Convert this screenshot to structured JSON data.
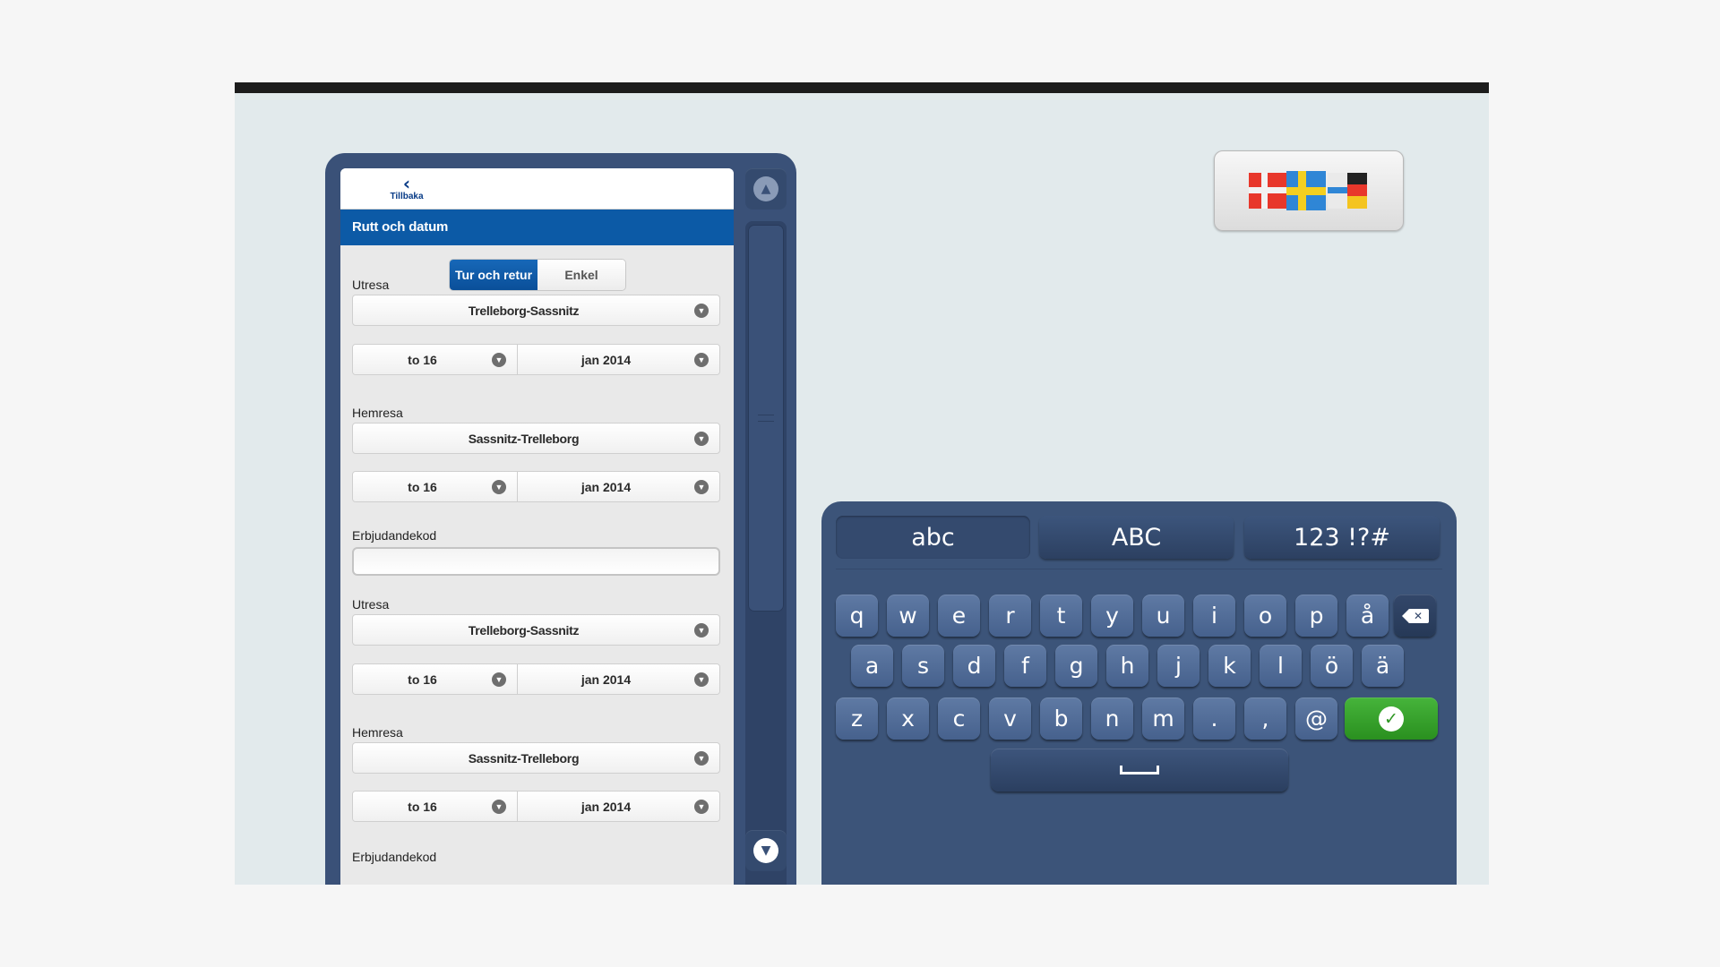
{
  "nav": {
    "back_label": "Tillbaka",
    "back_icon": "chevron-left-icon"
  },
  "section": {
    "title": "Rutt och datum"
  },
  "trip_type": {
    "options": [
      "Tur och retur",
      "Enkel"
    ],
    "selected": "Tur och retur"
  },
  "form": {
    "outbound_1": {
      "label": "Utresa",
      "route": "Trelleborg-Sassnitz",
      "day": "to 16",
      "month": "jan 2014"
    },
    "return_1": {
      "label": "Hemresa",
      "route": "Sassnitz-Trelleborg",
      "day": "to 16",
      "month": "jan 2014"
    },
    "promo_1": {
      "label": "Erbjudandekod",
      "value": ""
    },
    "outbound_2": {
      "label": "Utresa",
      "route": "Trelleborg-Sassnitz",
      "day": "to 16",
      "month": "jan 2014"
    },
    "return_2": {
      "label": "Hemresa",
      "route": "Sassnitz-Trelleborg",
      "day": "to 16",
      "month": "jan 2014"
    },
    "promo_2": {
      "label": "Erbjudandekod"
    }
  },
  "scroll": {
    "up_icon": "chevron-up-icon",
    "down_icon": "chevron-down-icon",
    "position": 0
  },
  "language": {
    "icon": "flags-icon",
    "flags": [
      "Denmark",
      "Sweden",
      "Germany"
    ]
  },
  "keyboard": {
    "modes": [
      "abc",
      "ABC",
      "123 !?#"
    ],
    "active_mode": "abc",
    "row1": [
      "q",
      "w",
      "e",
      "r",
      "t",
      "y",
      "u",
      "i",
      "o",
      "p",
      "å"
    ],
    "row2": [
      "a",
      "s",
      "d",
      "f",
      "g",
      "h",
      "j",
      "k",
      "l",
      "ö",
      "ä"
    ],
    "row3": [
      "z",
      "x",
      "c",
      "v",
      "b",
      "n",
      "m",
      ".",
      ",",
      "@"
    ],
    "special_icons": {
      "backspace": "backspace-icon",
      "enter": "checkmark-icon",
      "space": "space-bar-icon"
    }
  },
  "colors": {
    "brand_blue": "#0c5aa6",
    "frame": "#3a5178",
    "keyboard_bg": "#3c5479",
    "key": "#5470a0",
    "confirm_green": "#39a62e"
  }
}
